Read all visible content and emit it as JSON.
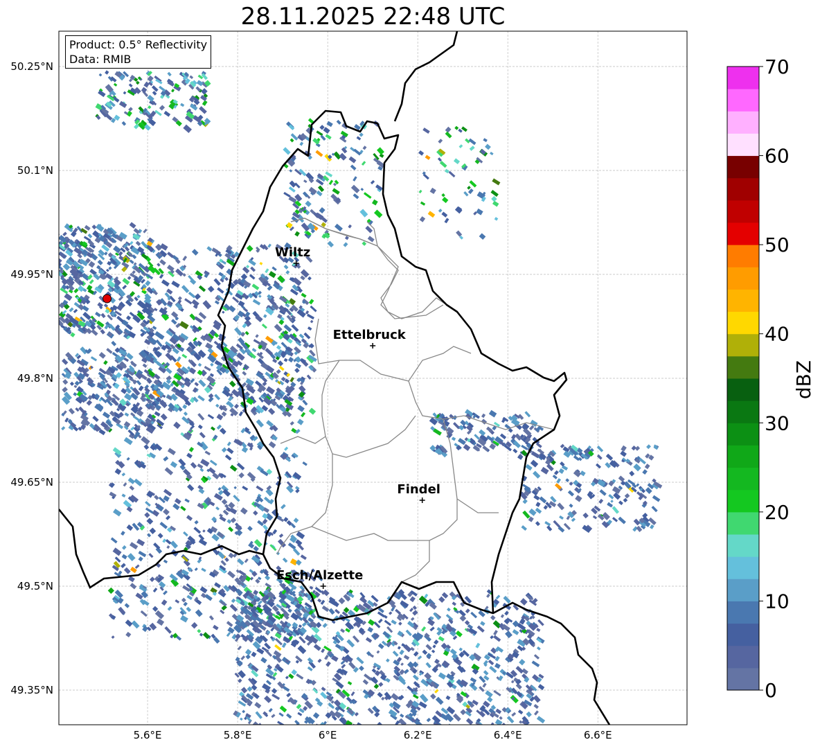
{
  "title": "28.11.2025 22:48 UTC",
  "info": {
    "product": "Product: 0.5° Reflectivity",
    "data": "Data: RMIB"
  },
  "axes": {
    "lon_ticks": [
      {
        "v": 5.6,
        "label": "5.6°E"
      },
      {
        "v": 5.8,
        "label": "5.8°E"
      },
      {
        "v": 6.0,
        "label": "6°E"
      },
      {
        "v": 6.2,
        "label": "6.2°E"
      },
      {
        "v": 6.4,
        "label": "6.4°E"
      },
      {
        "v": 6.6,
        "label": "6.6°E"
      }
    ],
    "lat_ticks": [
      {
        "v": 50.25,
        "label": "50.25°N"
      },
      {
        "v": 50.1,
        "label": "50.1°N"
      },
      {
        "v": 49.95,
        "label": "49.95°N"
      },
      {
        "v": 49.8,
        "label": "49.8°N"
      },
      {
        "v": 49.65,
        "label": "49.65°N"
      },
      {
        "v": 49.5,
        "label": "49.5°N"
      },
      {
        "v": 49.35,
        "label": "49.35°N"
      }
    ],
    "lon_range": [
      5.403,
      6.798
    ],
    "lat_range": [
      49.3,
      50.301
    ]
  },
  "cities": [
    {
      "name": "Wiltz",
      "lon": 5.93,
      "lat": 49.966
    },
    {
      "name": "Ettelbruck",
      "lon": 6.1,
      "lat": 49.847
    },
    {
      "name": "Findel",
      "lon": 6.21,
      "lat": 49.624
    },
    {
      "name": "Esch/Alzette",
      "lon": 5.99,
      "lat": 49.5
    }
  ],
  "radar_site": {
    "lon": 5.51,
    "lat": 49.915,
    "color": "#e00000"
  },
  "colorbar": {
    "label": "dBZ",
    "min": 0,
    "max": 70,
    "ticks": [
      "0",
      "10",
      "20",
      "30",
      "40",
      "50",
      "60",
      "70"
    ],
    "colors": [
      "#6474a4",
      "#5666a0",
      "#4560a0",
      "#4a78b0",
      "#5a9ec8",
      "#64c0dc",
      "#64d8c8",
      "#40d870",
      "#14c820",
      "#14b820",
      "#10a818",
      "#0c9014",
      "#0a7812",
      "#086010",
      "#447a10",
      "#b0b008",
      "#ffd800",
      "#ffb400",
      "#ff9c00",
      "#ff7c00",
      "#e40000",
      "#c00000",
      "#a00000",
      "#780000",
      "#ffe0ff",
      "#ffb0ff",
      "#ff68ff",
      "#ee30ee"
    ]
  }
}
